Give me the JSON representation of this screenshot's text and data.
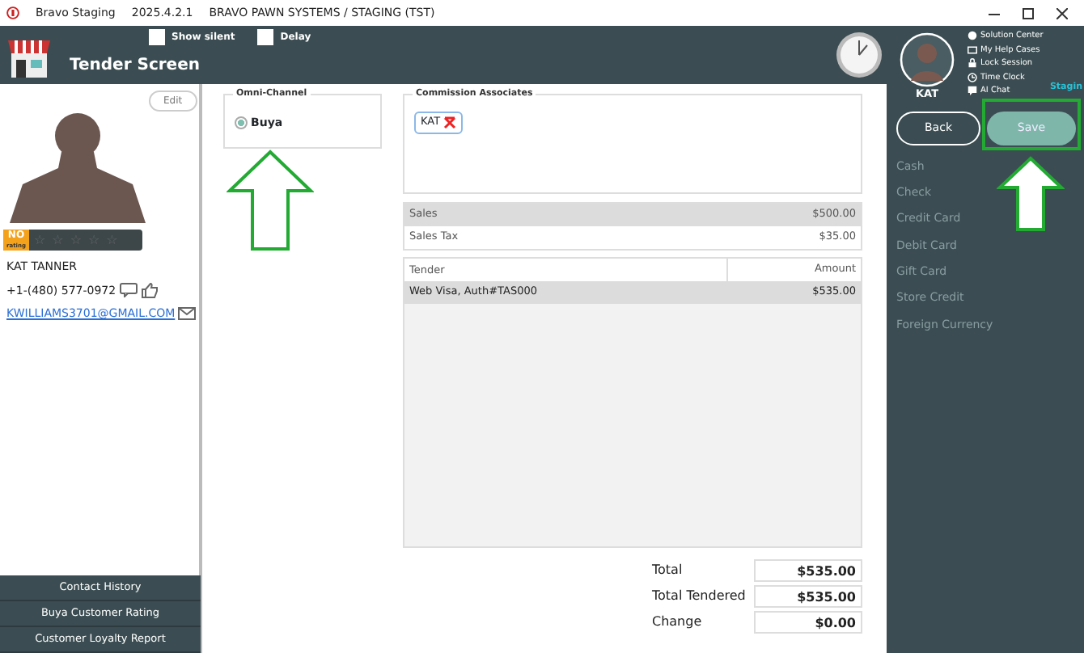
{
  "window": {
    "app": "Bravo Staging",
    "version": "2025.4.2.1",
    "title": "BRAVO PAWN SYSTEMS / STAGING (TST)"
  },
  "header": {
    "title": "Tender Screen",
    "options": [
      {
        "label": "Show silent",
        "checked": false
      },
      {
        "label": "Delay",
        "checked": false
      }
    ]
  },
  "customer": {
    "edit_label": "Edit",
    "rating_badge": "NO",
    "rating_sub": "rating",
    "stars": 0,
    "name": "KAT TANNER",
    "phone": "+1-(480) 577-0972",
    "email": "KWILLIAMS3701@GMAIL.COM"
  },
  "customer_actions": [
    "Contact History",
    "Buya Customer Rating",
    "Customer Loyalty Report"
  ],
  "omni_channel": {
    "legend": "Omni-Channel",
    "options": [
      {
        "label": "Buya",
        "selected": true
      }
    ]
  },
  "commission": {
    "legend": "Commission Associates",
    "associates": [
      "KAT"
    ]
  },
  "summary": [
    {
      "label": "Sales",
      "amount": "$500.00"
    },
    {
      "label": "Sales Tax",
      "amount": "$35.00"
    }
  ],
  "tenders": {
    "columns": [
      "Tender",
      "Amount"
    ],
    "rows": [
      {
        "tender": "Web Visa, Auth#TAS000",
        "amount": "$535.00",
        "selected": true
      }
    ]
  },
  "totals": [
    {
      "label": "Total",
      "value": "$535.00"
    },
    {
      "label": "Total Tendered",
      "value": "$535.00"
    },
    {
      "label": "Change",
      "value": "$0.00"
    }
  ],
  "user": {
    "name": "KAT",
    "links": [
      "Solution Center",
      "My Help Cases",
      "Lock Session",
      "Time Clock",
      "AI Chat"
    ],
    "environment": "Stagin"
  },
  "actions": [
    {
      "label": "Back",
      "kind": "outline"
    },
    {
      "label": "Save",
      "kind": "filled"
    }
  ],
  "payment_methods": [
    "Cash",
    "Check",
    "Credit Card",
    "Debit Card",
    "Gift Card",
    "Store Credit",
    "Foreign Currency"
  ]
}
